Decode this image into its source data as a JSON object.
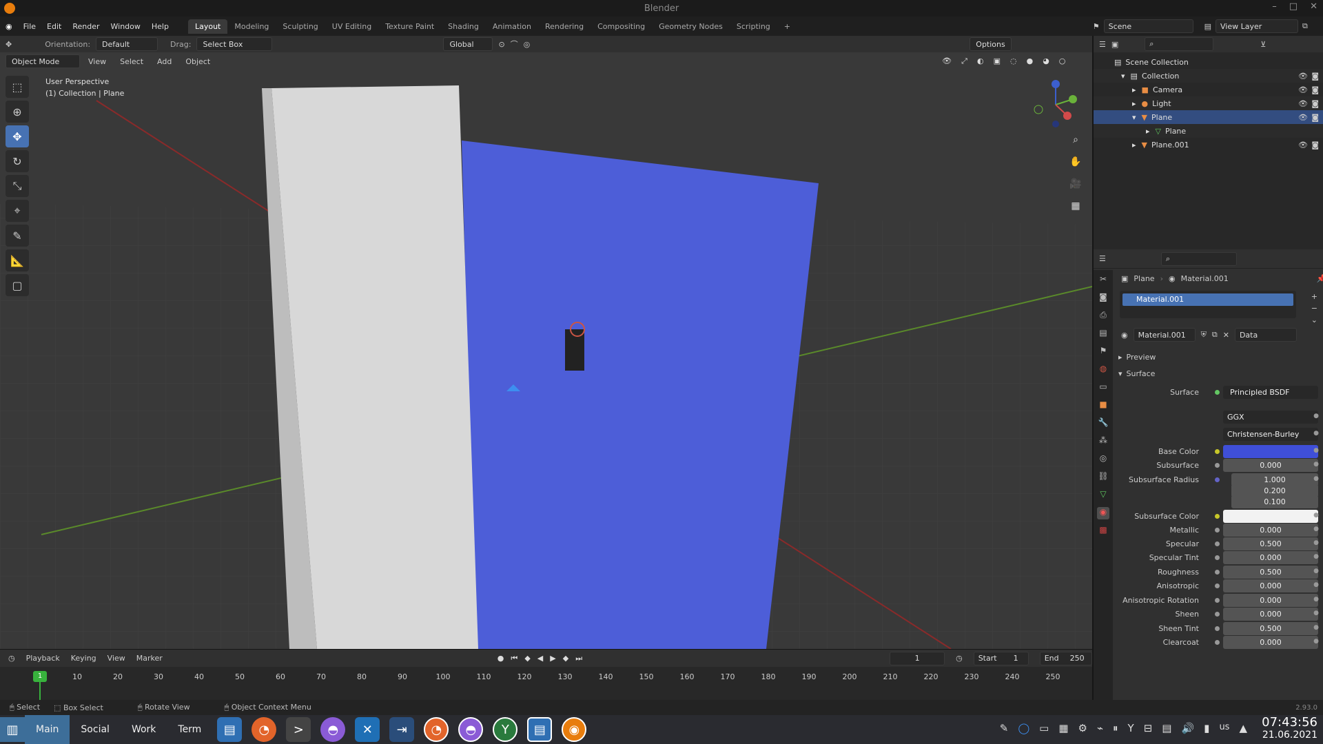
{
  "window": {
    "title": "Blender"
  },
  "menu": {
    "items": [
      "File",
      "Edit",
      "Render",
      "Window",
      "Help"
    ]
  },
  "workspaces": [
    "Layout",
    "Modeling",
    "Sculpting",
    "UV Editing",
    "Texture Paint",
    "Shading",
    "Animation",
    "Rendering",
    "Compositing",
    "Geometry Nodes",
    "Scripting",
    "+"
  ],
  "scene": {
    "scene_name": "Scene",
    "view_layer": "View Layer"
  },
  "tool_header": {
    "orientation_label": "Orientation:",
    "orientation_value": "Default",
    "drag_label": "Drag:",
    "drag_value": "Select Box",
    "transform": "Global",
    "options": "Options"
  },
  "viewport_header": {
    "mode": "Object Mode",
    "menus": [
      "View",
      "Select",
      "Add",
      "Object"
    ]
  },
  "viewport": {
    "info_line1": "User Perspective",
    "info_line2": "(1) Collection | Plane"
  },
  "outliner": {
    "rows": [
      {
        "label": "Scene Collection",
        "indent": 0
      },
      {
        "label": "Collection",
        "indent": 1
      },
      {
        "label": "Camera",
        "indent": 2
      },
      {
        "label": "Light",
        "indent": 2
      },
      {
        "label": "Plane",
        "indent": 2
      },
      {
        "label": "Plane",
        "indent": 3
      },
      {
        "label": "Plane.001",
        "indent": 2
      }
    ]
  },
  "properties": {
    "breadcrumb_object": "Plane",
    "breadcrumb_material": "Material.001",
    "slot": "Material.001",
    "material_name": "Material.001",
    "link": "Data",
    "preview": "Preview",
    "surface_panel": "Surface",
    "surface_label": "Surface",
    "surface_shader": "Principled BSDF",
    "distribution": "GGX",
    "subsurface_method": "Christensen-Burley",
    "base_color": "#3f4fd8",
    "subsurface_color": "#f2f2f2",
    "fields": [
      {
        "label": "Base Color",
        "value": ""
      },
      {
        "label": "Subsurface",
        "value": "0.000"
      },
      {
        "label": "Subsurface Radius",
        "value": "1.000"
      },
      {
        "label": "",
        "value": "0.200"
      },
      {
        "label": "",
        "value": "0.100"
      },
      {
        "label": "Subsurface Color",
        "value": ""
      },
      {
        "label": "Metallic",
        "value": "0.000"
      },
      {
        "label": "Specular",
        "value": "0.500"
      },
      {
        "label": "Specular Tint",
        "value": "0.000"
      },
      {
        "label": "Roughness",
        "value": "0.500"
      },
      {
        "label": "Anisotropic",
        "value": "0.000"
      },
      {
        "label": "Anisotropic Rotation",
        "value": "0.000"
      },
      {
        "label": "Sheen",
        "value": "0.000"
      },
      {
        "label": "Sheen Tint",
        "value": "0.500"
      },
      {
        "label": "Clearcoat",
        "value": "0.000"
      }
    ]
  },
  "timeline": {
    "menus": [
      "Playback",
      "Keying",
      "View",
      "Marker"
    ],
    "current_frame": "1",
    "start_label": "Start",
    "start": "1",
    "end_label": "End",
    "end": "250",
    "ticks": [
      "10",
      "20",
      "30",
      "40",
      "50",
      "60",
      "70",
      "80",
      "90",
      "100",
      "110",
      "120",
      "130",
      "140",
      "150",
      "160",
      "170",
      "180",
      "190",
      "200",
      "210",
      "220",
      "230",
      "240",
      "250"
    ],
    "playhead": "1"
  },
  "status": {
    "select": "Select",
    "box_select": "Box Select",
    "rotate": "Rotate View",
    "context": "Object Context Menu",
    "version": "2.93.0"
  },
  "taskbar": {
    "workspaces": [
      "Main",
      "Social",
      "Work",
      "Term"
    ],
    "lang": "us",
    "time": "07:43:56",
    "date": "21.06.2021"
  }
}
